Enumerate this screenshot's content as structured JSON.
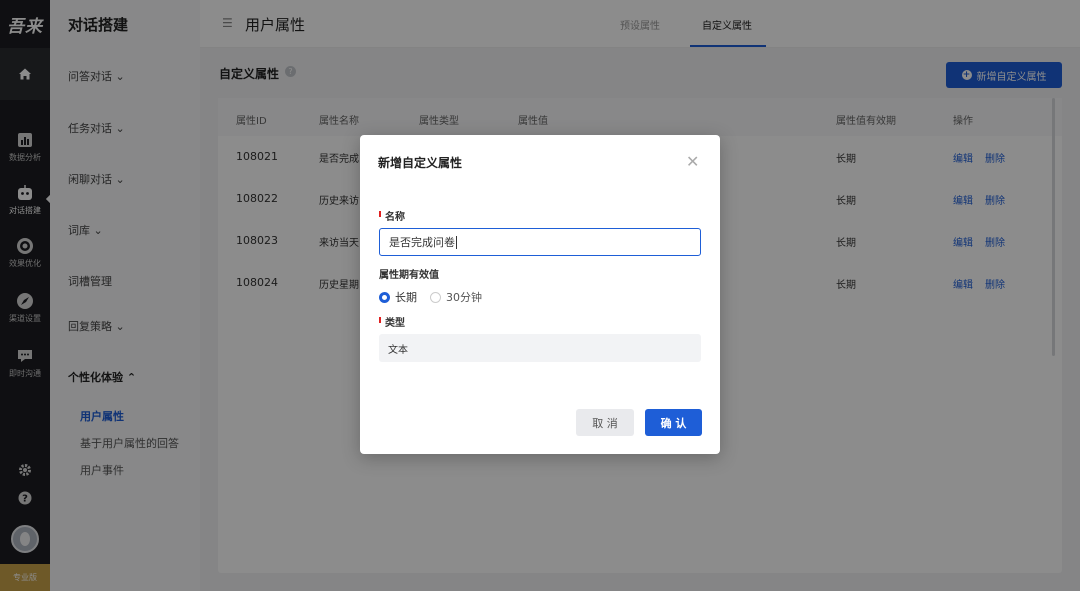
{
  "rail": {
    "logo": "吾来",
    "items": [
      {
        "label": "数据分析",
        "icon": "chart-icon"
      },
      {
        "label": "对话搭建",
        "icon": "robot-icon"
      },
      {
        "label": "效果优化",
        "icon": "target-icon"
      },
      {
        "label": "渠道设置",
        "icon": "compass-icon"
      },
      {
        "label": "即时沟通",
        "icon": "chat-icon"
      }
    ],
    "pro_label": "专业版"
  },
  "sidebar": {
    "title": "对话搭建",
    "groups": [
      "问答对话 ⌄",
      "任务对话 ⌄",
      "闲聊对话 ⌄",
      "词库 ⌄",
      "词槽管理",
      "回复策略 ⌄",
      "个性化体验 ⌃"
    ],
    "subitems": [
      "用户属性",
      "基于用户属性的回答",
      "用户事件"
    ]
  },
  "header": {
    "title": "用户属性",
    "tabs": [
      "预设属性",
      "自定义属性"
    ],
    "active_tab": "自定义属性"
  },
  "main": {
    "section_title": "自定义属性",
    "add_button": "新增自定义属性",
    "columns": [
      "属性ID",
      "属性名称",
      "属性类型",
      "属性值",
      "属性值有效期",
      "操作"
    ],
    "rows": [
      {
        "id": "108021",
        "name": "是否完成",
        "validity": "长期",
        "edit": "编辑",
        "delete": "删除"
      },
      {
        "id": "108022",
        "name": "历史来访",
        "validity": "长期",
        "edit": "编辑",
        "delete": "删除"
      },
      {
        "id": "108023",
        "name": "来访当天",
        "validity": "长期",
        "edit": "编辑",
        "delete": "删除"
      },
      {
        "id": "108024",
        "name": "历史星期",
        "validity": "长期",
        "edit": "编辑",
        "delete": "删除"
      }
    ]
  },
  "modal": {
    "title": "新增自定义属性",
    "name_label": "名称",
    "name_value": "是否完成问卷",
    "validity_label": "属性期有效值",
    "validity_options": [
      "长期",
      "30分钟"
    ],
    "validity_selected": "长期",
    "type_label": "类型",
    "type_value": "文本",
    "cancel": "取 消",
    "confirm": "确 认"
  },
  "colors": {
    "accent": "#1e5ed7",
    "rail_bg": "#1c1d21",
    "required": "#e02020"
  }
}
